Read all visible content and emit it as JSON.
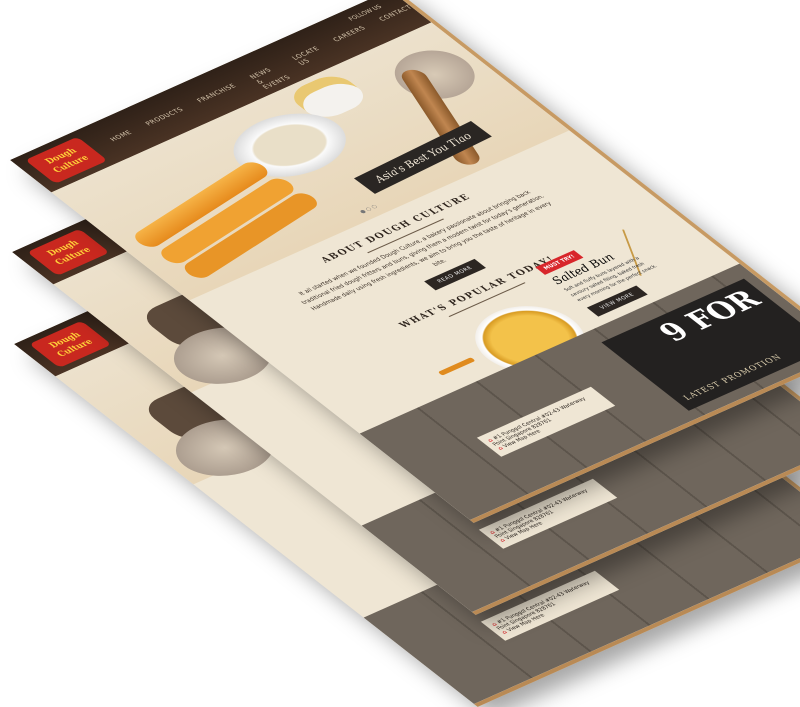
{
  "site": {
    "logo_text": "Dough Culture",
    "nav": [
      "HOME",
      "PRODUCTS",
      "FRANCHISE",
      "NEWS & EVENTS",
      "LOCATE US",
      "CAREERS",
      "CONTACT"
    ],
    "utility": "FOLLOW US"
  },
  "hero": {
    "tagline": "Asia's Best You Tiao",
    "slider_dots": "● ○ ○"
  },
  "about": {
    "heading": "ABOUT DOUGH CULTURE",
    "text": "It all started when we founded Dough Culture, a bakery passionate about bringing back traditional fried dough fritters and buns, giving them a modern twist for today's generation. Handmade daily using fresh ingredients, we aim to bring you the taste of heritage in every bite.",
    "button": "READ MORE"
  },
  "popular": {
    "heading": "WHAT'S POPULAR TODAY!",
    "badge": "MUST TRY!",
    "product_name": "Salted Bun",
    "description": "Soft and fluffy buns layered with a savoury salted filling, baked fresh every morning for the perfect snack.",
    "button": "VIEW MORE"
  },
  "promotion": {
    "label": "LATEST PROMOTION",
    "big_text": "9 FOR"
  },
  "footer": {
    "address": "#1 Punggol Central #02-43 Waterway Point Singapore 828761",
    "map_link": "View Map Here"
  },
  "colors": {
    "header": "#3a281c",
    "accent": "#d8262b",
    "paper": "#efe6d4",
    "wood": "#c79a63"
  }
}
